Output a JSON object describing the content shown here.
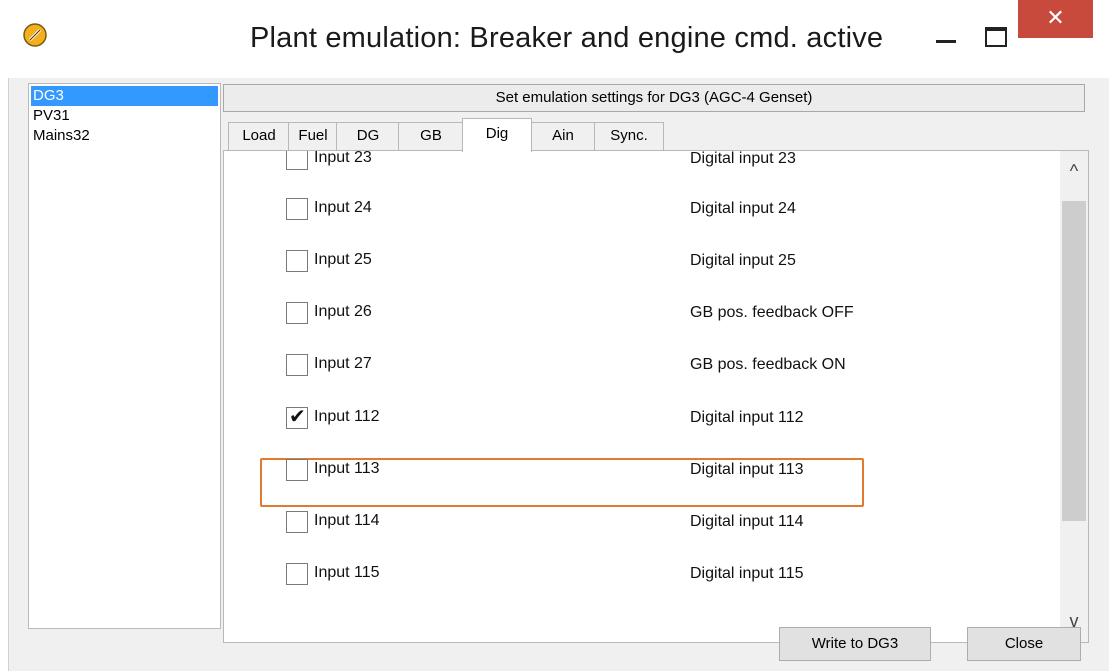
{
  "window": {
    "title": "Plant emulation: Breaker and engine cmd. active",
    "close_glyph": "✕"
  },
  "devices": [
    "DG3",
    "PV31",
    "Mains32"
  ],
  "selected_device": "DG3",
  "header": "Set emulation settings for DG3 (AGC-4 Genset)",
  "tabs": [
    "Load",
    "Fuel",
    "DG",
    "GB",
    "Dig",
    "Ain",
    "Sync."
  ],
  "active_tab": "Dig",
  "inputs": [
    {
      "label": "Input 23",
      "description": "Digital input 23",
      "checked": false
    },
    {
      "label": "Input 24",
      "description": "Digital input 24",
      "checked": false
    },
    {
      "label": "Input 25",
      "description": "Digital input 25",
      "checked": false
    },
    {
      "label": "Input 26",
      "description": "GB pos. feedback OFF",
      "checked": false
    },
    {
      "label": "Input 27",
      "description": "GB pos. feedback ON",
      "checked": false
    },
    {
      "label": "Input 112",
      "description": "Digital input 112",
      "checked": true
    },
    {
      "label": "Input 113",
      "description": "Digital input 113",
      "checked": false
    },
    {
      "label": "Input 114",
      "description": "Digital input 114",
      "checked": false
    },
    {
      "label": "Input 115",
      "description": "Digital input 115",
      "checked": false
    }
  ],
  "scroll": {
    "up_glyph": "^",
    "down_glyph": "v"
  },
  "buttons": {
    "write": "Write to DG3",
    "close": "Close"
  },
  "colors": {
    "highlight": "#e07a2e",
    "selection": "#3399ff",
    "close_button": "#c74a3c"
  },
  "icons": [
    "app-icon",
    "minimize-icon",
    "maximize-icon",
    "close-icon",
    "checkmark-icon",
    "chevron-up-icon",
    "chevron-down-icon"
  ]
}
